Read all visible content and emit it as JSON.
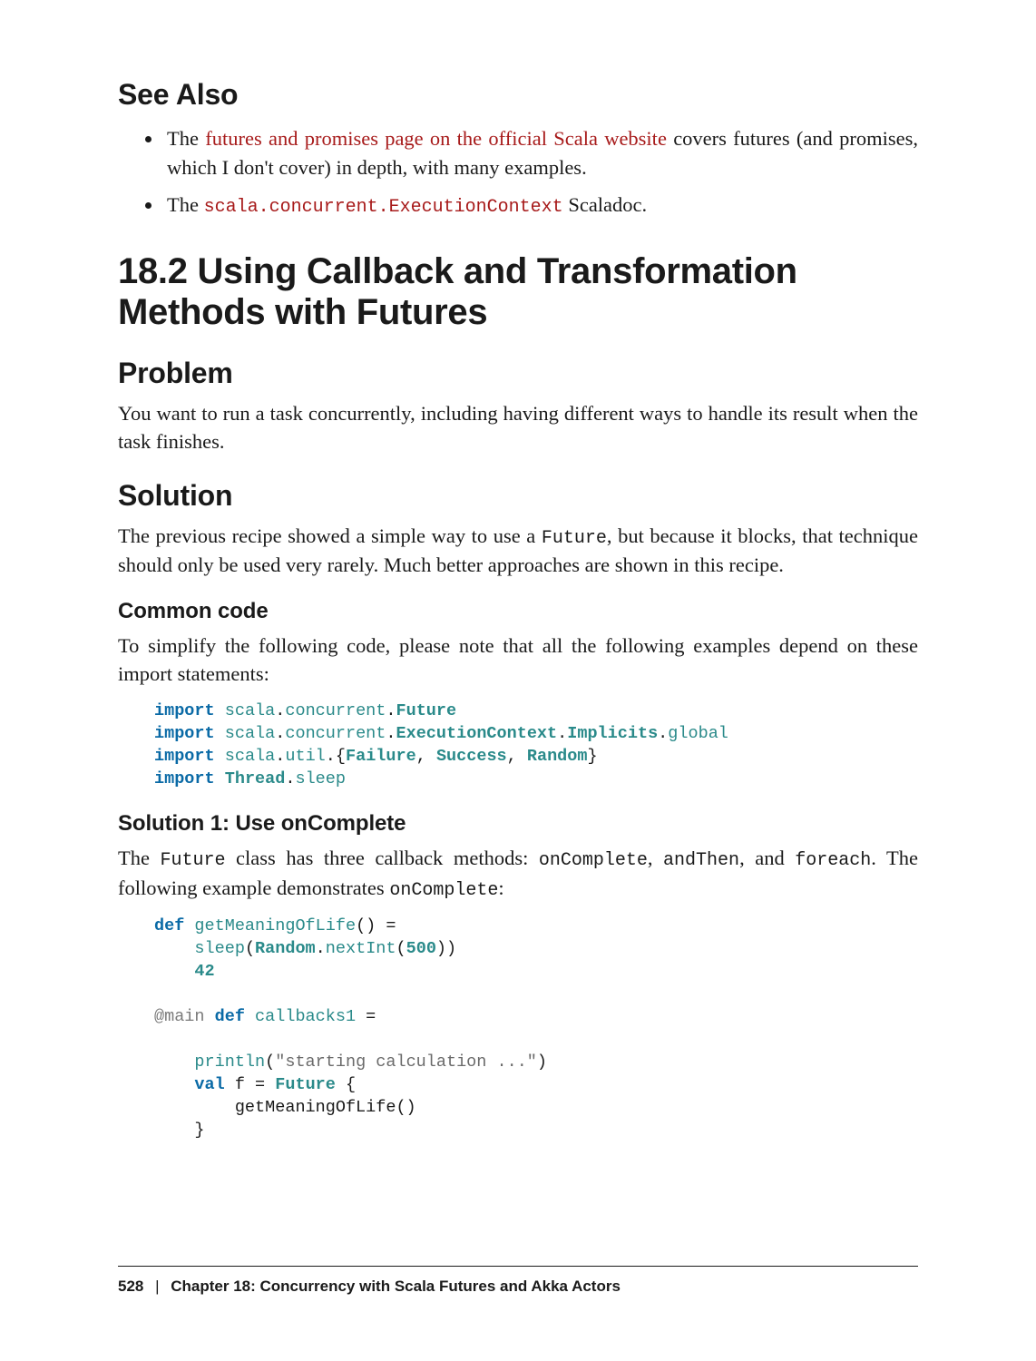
{
  "headings": {
    "see_also": "See Also",
    "section_title": "18.2 Using Callback and Transformation Methods with Futures",
    "problem": "Problem",
    "solution": "Solution",
    "common_code": "Common code",
    "solution1": "Solution 1: Use onComplete"
  },
  "bullets": {
    "b1_pre": "The ",
    "b1_link": "futures and promises page on the official Scala website",
    "b1_post": " covers futures (and promises, which I don't cover) in depth, with many examples.",
    "b2_pre": "The ",
    "b2_code": "scala.concurrent.ExecutionContext",
    "b2_post": " Scaladoc."
  },
  "paras": {
    "problem_text": "You want to run a task concurrently, including having different ways to handle its result when the task finishes.",
    "solution_p1a": "The previous recipe showed a simple way to use a ",
    "solution_p1_code": "Future",
    "solution_p1b": ", but because it blocks, that technique should only be used very rarely. Much better approaches are shown in this recipe.",
    "common_p": "To simplify the following code, please note that all the following examples depend on these import statements:",
    "sol1_p1a": "The ",
    "sol1_p1_code1": "Future",
    "sol1_p1b": " class has three callback methods: ",
    "sol1_p1_code2": "onComplete",
    "sol1_p1c": ", ",
    "sol1_p1_code3": "andThen",
    "sol1_p1d": ", and ",
    "sol1_p1_code4": "foreach",
    "sol1_p1e": ". The following example demonstrates ",
    "sol1_p1_code5": "onComplete",
    "sol1_p1f": ":"
  },
  "code": {
    "imports": {
      "kw_import": "import",
      "l1_a": "scala",
      "l1_b": "concurrent",
      "l1_c": "Future",
      "l2_a": "scala",
      "l2_b": "concurrent",
      "l2_c": "ExecutionContext",
      "l2_d": "Implicits",
      "l2_e": "global",
      "l3_a": "scala",
      "l3_b": "util",
      "l3_c": "Failure",
      "l3_d": "Success",
      "l3_e": "Random",
      "l4_a": "Thread",
      "l4_b": "sleep"
    },
    "example": {
      "kw_def": "def",
      "kw_val": "val",
      "fn_getMeaning": "getMeaningOfLife",
      "parens": "() =",
      "fn_sleep": "sleep",
      "cls_random": "Random",
      "fn_nextInt": "nextInt",
      "num_500": "500",
      "num_42": "42",
      "ann_main": "@main",
      "fn_callbacks1": "callbacks1",
      "eq": " =",
      "fn_println": "println",
      "str_starting": "\"starting calculation ...\"",
      "id_f": "f",
      "cls_future": "Future",
      "lbrace": "{",
      "rbrace": "}",
      "call_getMeaning": "getMeaningOfLife()"
    }
  },
  "footer": {
    "page": "528",
    "sep": "|",
    "chapter": "Chapter 18: Concurrency with Scala Futures and Akka Actors"
  }
}
